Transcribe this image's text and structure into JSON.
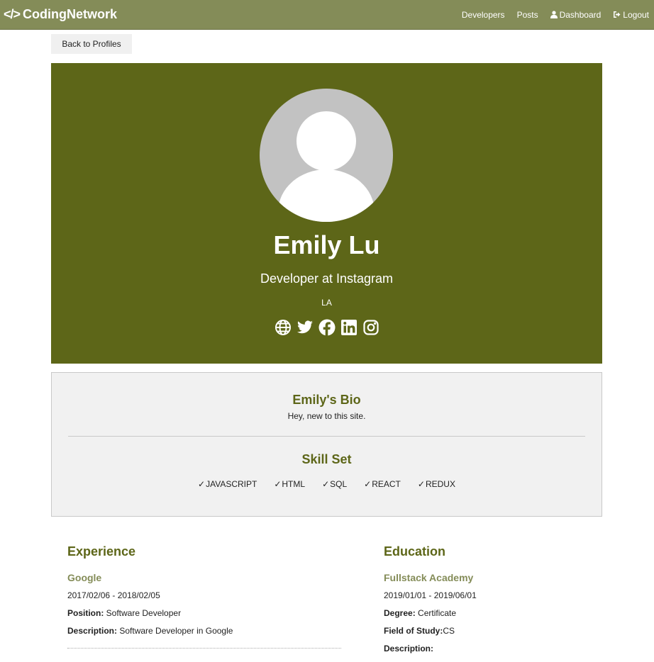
{
  "navbar": {
    "brand_icon": "</>",
    "brand": "CodingNetwork",
    "links": {
      "developers": "Developers",
      "posts": "Posts",
      "dashboard": "Dashboard",
      "logout": "Logout"
    }
  },
  "back_button": "Back to Profiles",
  "profile": {
    "name": "Emily Lu",
    "status": "Developer at Instagram",
    "location": "LA",
    "social_icons": [
      "globe-icon",
      "twitter-icon",
      "facebook-icon",
      "linkedin-icon",
      "instagram-icon"
    ]
  },
  "bio": {
    "title": "Emily's Bio",
    "text": "Hey, new to this site."
  },
  "skills": {
    "title": "Skill Set",
    "items": [
      "JAVASCRIPT",
      "HTML",
      "SQL",
      "REACT",
      "REDUX"
    ]
  },
  "experience": {
    "title": "Experience",
    "items": [
      {
        "company": "Google",
        "dates": "2017/02/06 - 2018/02/05",
        "position_label": "Position:",
        "position": "Software Developer",
        "description_label": "Description:",
        "description": "Software Developer in Google"
      }
    ]
  },
  "education": {
    "title": "Education",
    "items": [
      {
        "school": "Fullstack Academy",
        "dates": "2019/01/01 - 2019/06/01",
        "degree_label": "Degree:",
        "degree": "Certificate",
        "field_label": "Field of Study:",
        "field": "CS",
        "description_label": "Description:",
        "description": ""
      }
    ]
  },
  "colors": {
    "navbar": "#848c58",
    "profile_bg": "#5d6618",
    "heading": "#5d6618",
    "subheading": "#848c58"
  }
}
